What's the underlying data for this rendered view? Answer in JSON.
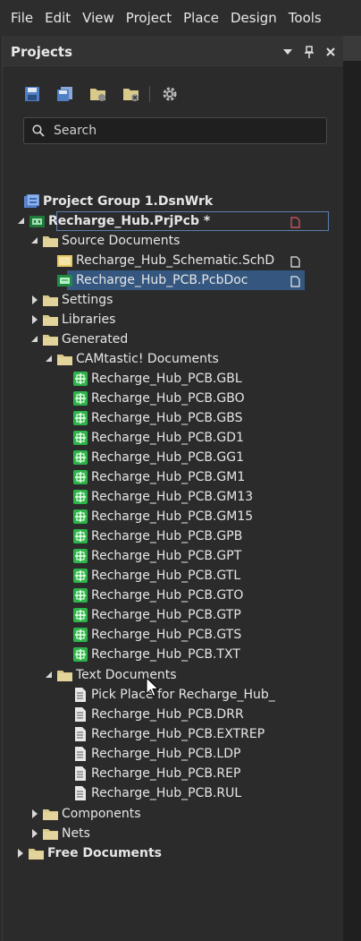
{
  "menubar": {
    "items": [
      "File",
      "Edit",
      "View",
      "Project",
      "Place",
      "Design",
      "Tools"
    ]
  },
  "panel": {
    "title": "Projects",
    "header_icons": [
      "dropdown-arrow-icon",
      "pin-icon",
      "close-icon"
    ]
  },
  "toolbar": {
    "icons": [
      "save-icon",
      "save-all-icon",
      "project-options-icon",
      "close-project-icon",
      "settings-gear-icon"
    ]
  },
  "search": {
    "placeholder": "Search"
  },
  "tree": {
    "project_group": "Project Group 1.DsnWrk",
    "project": "Recharge_Hub.PrjPcb *",
    "source_documents": "Source Documents",
    "schematic": "Recharge_Hub_Schematic.SchD",
    "pcb": "Recharge_Hub_PCB.PcbDoc",
    "settings": "Settings",
    "libraries": "Libraries",
    "generated": "Generated",
    "camtastic": "CAMtastic! Documents",
    "cam_files": [
      "Recharge_Hub_PCB.GBL",
      "Recharge_Hub_PCB.GBO",
      "Recharge_Hub_PCB.GBS",
      "Recharge_Hub_PCB.GD1",
      "Recharge_Hub_PCB.GG1",
      "Recharge_Hub_PCB.GM1",
      "Recharge_Hub_PCB.GM13",
      "Recharge_Hub_PCB.GM15",
      "Recharge_Hub_PCB.GPB",
      "Recharge_Hub_PCB.GPT",
      "Recharge_Hub_PCB.GTL",
      "Recharge_Hub_PCB.GTO",
      "Recharge_Hub_PCB.GTP",
      "Recharge_Hub_PCB.GTS",
      "Recharge_Hub_PCB.TXT"
    ],
    "text_documents": "Text Documents",
    "text_files": [
      "Pick Place for Recharge_Hub_",
      "Recharge_Hub_PCB.DRR",
      "Recharge_Hub_PCB.EXTREP",
      "Recharge_Hub_PCB.LDP",
      "Recharge_Hub_PCB.REP",
      "Recharge_Hub_PCB.RUL"
    ],
    "components": "Components",
    "nets": "Nets",
    "free_documents": "Free Documents"
  },
  "colors": {
    "folder": "#d9c98a",
    "cam_icon": "#2db34a",
    "selection": "#35577f",
    "modified_mark": "#e0556a"
  }
}
